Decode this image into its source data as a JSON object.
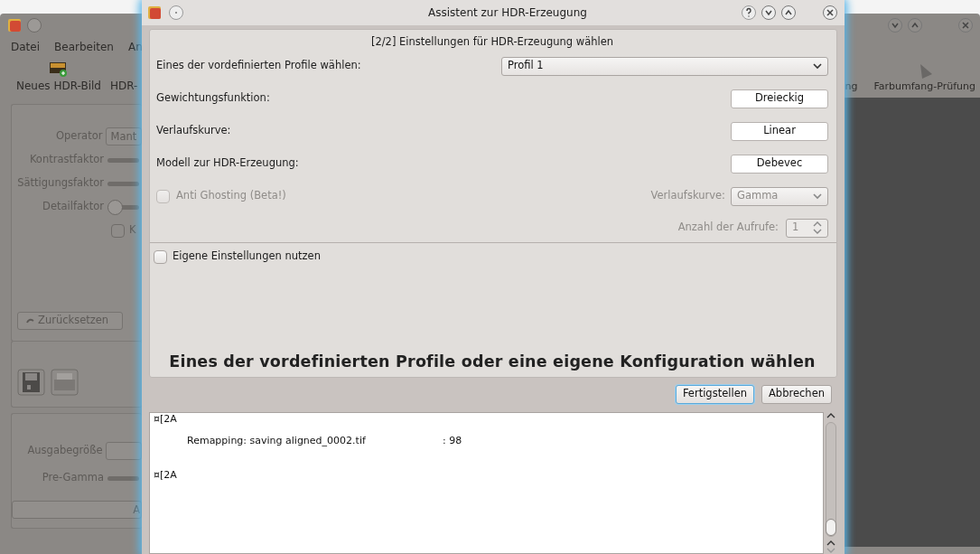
{
  "background_window": {
    "menu": [
      {
        "label": "Datei"
      },
      {
        "label": "Bearbeiten"
      },
      {
        "label": "An"
      }
    ],
    "toolbar": [
      {
        "label": "Neues HDR-Bild",
        "kind": "new"
      },
      {
        "label": "HDR-",
        "kind": "plain"
      }
    ],
    "toolbar_right": [
      {
        "label": "ng",
        "kind": "plain"
      },
      {
        "label": "Farbumfang-Prüfung",
        "kind": "gamut"
      }
    ],
    "operator": {
      "label": "Operator",
      "value": "Mant"
    },
    "sliders": [
      {
        "label": "Kontrastfaktor"
      },
      {
        "label": "Sättigungsfaktor"
      },
      {
        "label": "Detailfaktor",
        "level": 0
      }
    ],
    "checkbox": {
      "label": "K",
      "checked": false
    },
    "reset_button": "Zurücksetzen",
    "output_size": {
      "label": "Ausgabegröße"
    },
    "pre_gamma": {
      "label": "Pre-Gamma"
    },
    "apply_button": "A"
  },
  "dialog": {
    "title": "Assistent zur HDR-Erzeugung",
    "header": "[2/2] Einstellungen für HDR-Erzeugung wählen",
    "profile": {
      "label": "Eines der vordefinierten Profile wählen:",
      "value": "Profil 1"
    },
    "settings": [
      {
        "label": "Gewichtungsfunktion:",
        "value": "Dreieckig"
      },
      {
        "label": "Verlaufskurve:",
        "value": "Linear"
      },
      {
        "label": "Modell zur HDR-Erzeugung:",
        "value": "Debevec"
      }
    ],
    "anti_ghosting": {
      "label": "Anti Ghosting (Beta!)",
      "checked": false,
      "disabled": true
    },
    "curve": {
      "label": "Verlaufskurve:",
      "value": "Gamma",
      "disabled": true
    },
    "iterations": {
      "label": "Anzahl der Aufrufe:",
      "value": "1",
      "disabled": true
    },
    "custom": {
      "label": "Eigene Einstellungen nutzen",
      "checked": false
    },
    "footer_text": "Eines der vordefinierten Profile oder eine eigene Konfiguration wählen",
    "buttons": [
      {
        "label": "Fertigstellen",
        "default": true
      },
      {
        "label": "Abbrechen",
        "default": false
      }
    ],
    "log": [
      {
        "text": "¤[2A"
      },
      {
        "text": "Remapping: saving aligned_0002.tif",
        "value": ":  98"
      },
      {
        "text": "¤[2A"
      }
    ]
  }
}
